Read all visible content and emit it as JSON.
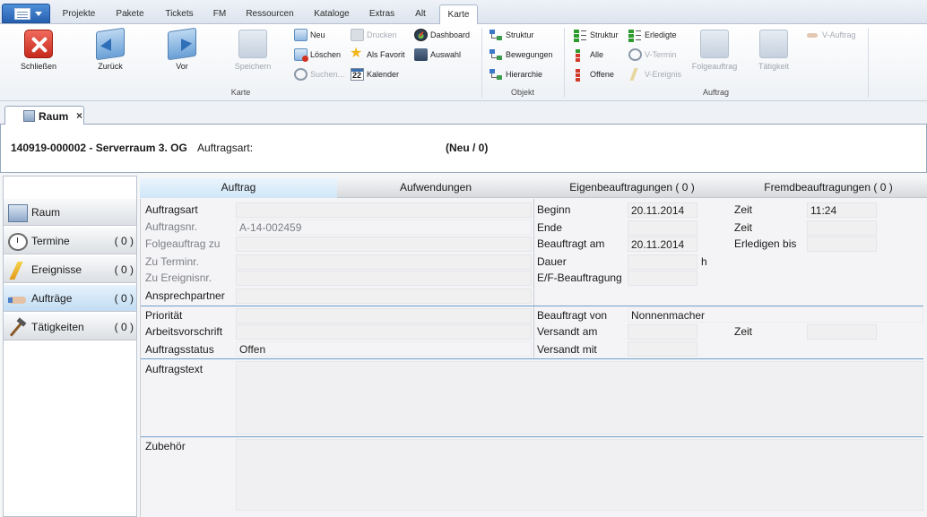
{
  "ribbon_tabs": [
    "Projekte",
    "Pakete",
    "Tickets",
    "FM",
    "Ressourcen",
    "Kataloge",
    "Extras",
    "Alt",
    "Karte"
  ],
  "ribbon": {
    "karte": {
      "label": "Karte",
      "close": "Schließen",
      "back": "Zurück",
      "forward": "Vor",
      "save": "Speichern",
      "new": "Neu",
      "delete": "Löschen",
      "search": "Suchen...",
      "print": "Drucken",
      "favorite": "Als Favorit",
      "calendar": "Kalender",
      "dashboard": "Dashboard",
      "selection": "Auswahl"
    },
    "objekt": {
      "label": "Objekt",
      "structure": "Struktur",
      "movements": "Bewegungen",
      "hierarchy": "Hierarchie"
    },
    "auftrag": {
      "label": "Auftrag",
      "structure": "Struktur",
      "all": "Alle",
      "open": "Offene",
      "done": "Erledigte",
      "v_termin": "V-Termin",
      "v_ereignis": "V-Ereignis",
      "followup": "Folgeauftrag",
      "activity": "Tätigkeit",
      "v_auftrag": "V-Auftrag"
    }
  },
  "doc_tab": {
    "label": "Raum",
    "close": "×"
  },
  "header": {
    "title": "140919-000002 - Serverraum 3. OG",
    "auftragsart_label": "Auftragsart:",
    "status": "(Neu / 0)"
  },
  "nav": [
    {
      "label": "Raum",
      "count": ""
    },
    {
      "label": "Termine",
      "count": "( 0 )"
    },
    {
      "label": "Ereignisse",
      "count": "( 0 )"
    },
    {
      "label": "Aufträge",
      "count": "( 0 )"
    },
    {
      "label": "Tätigkeiten",
      "count": "( 0 )"
    }
  ],
  "content_tabs": [
    "Auftrag",
    "Aufwendungen",
    "Eigenbeauftragungen ( 0 )",
    "Fremdbeauftragungen ( 0 )"
  ],
  "form": {
    "auftragsart": {
      "label": "Auftragsart",
      "value": ""
    },
    "auftragsnr": {
      "label": "Auftragsnr.",
      "value": "A-14-002459"
    },
    "folgeauftrag": {
      "label": "Folgeauftrag zu",
      "value": ""
    },
    "zu_terminnr": {
      "label": "Zu Terminr.",
      "value": ""
    },
    "zu_ereignisnr": {
      "label": "Zu Ereignisnr.",
      "value": ""
    },
    "ansprechpartner": {
      "label": "Ansprechpartner",
      "value": ""
    },
    "beginn": {
      "label": "Beginn",
      "value": "20.11.2014"
    },
    "ende": {
      "label": "Ende",
      "value": ""
    },
    "beauftragt_am": {
      "label": "Beauftragt am",
      "value": "20.11.2014"
    },
    "dauer": {
      "label": "Dauer",
      "value": "",
      "unit": "h"
    },
    "ef_beauftragung": {
      "label": "E/F-Beauftragung",
      "value": ""
    },
    "zeit1": {
      "label": "Zeit",
      "value": "11:24"
    },
    "zeit2": {
      "label": "Zeit",
      "value": ""
    },
    "erledigen_bis": {
      "label": "Erledigen bis",
      "value": ""
    },
    "prioritaet": {
      "label": "Priorität",
      "value": ""
    },
    "arbeitsvorschrift": {
      "label": "Arbeitsvorschrift",
      "value": ""
    },
    "auftragsstatus": {
      "label": "Auftragsstatus",
      "value": "Offen"
    },
    "beauftragt_von": {
      "label": "Beauftragt von",
      "value": "Nonnenmacher"
    },
    "versandt_am": {
      "label": "Versandt am",
      "value": ""
    },
    "versandt_mit": {
      "label": "Versandt mit",
      "value": ""
    },
    "zeit3": {
      "label": "Zeit",
      "value": ""
    },
    "auftragstext": {
      "label": "Auftragstext",
      "value": ""
    },
    "zubehoer": {
      "label": "Zubehör",
      "value": ""
    }
  }
}
